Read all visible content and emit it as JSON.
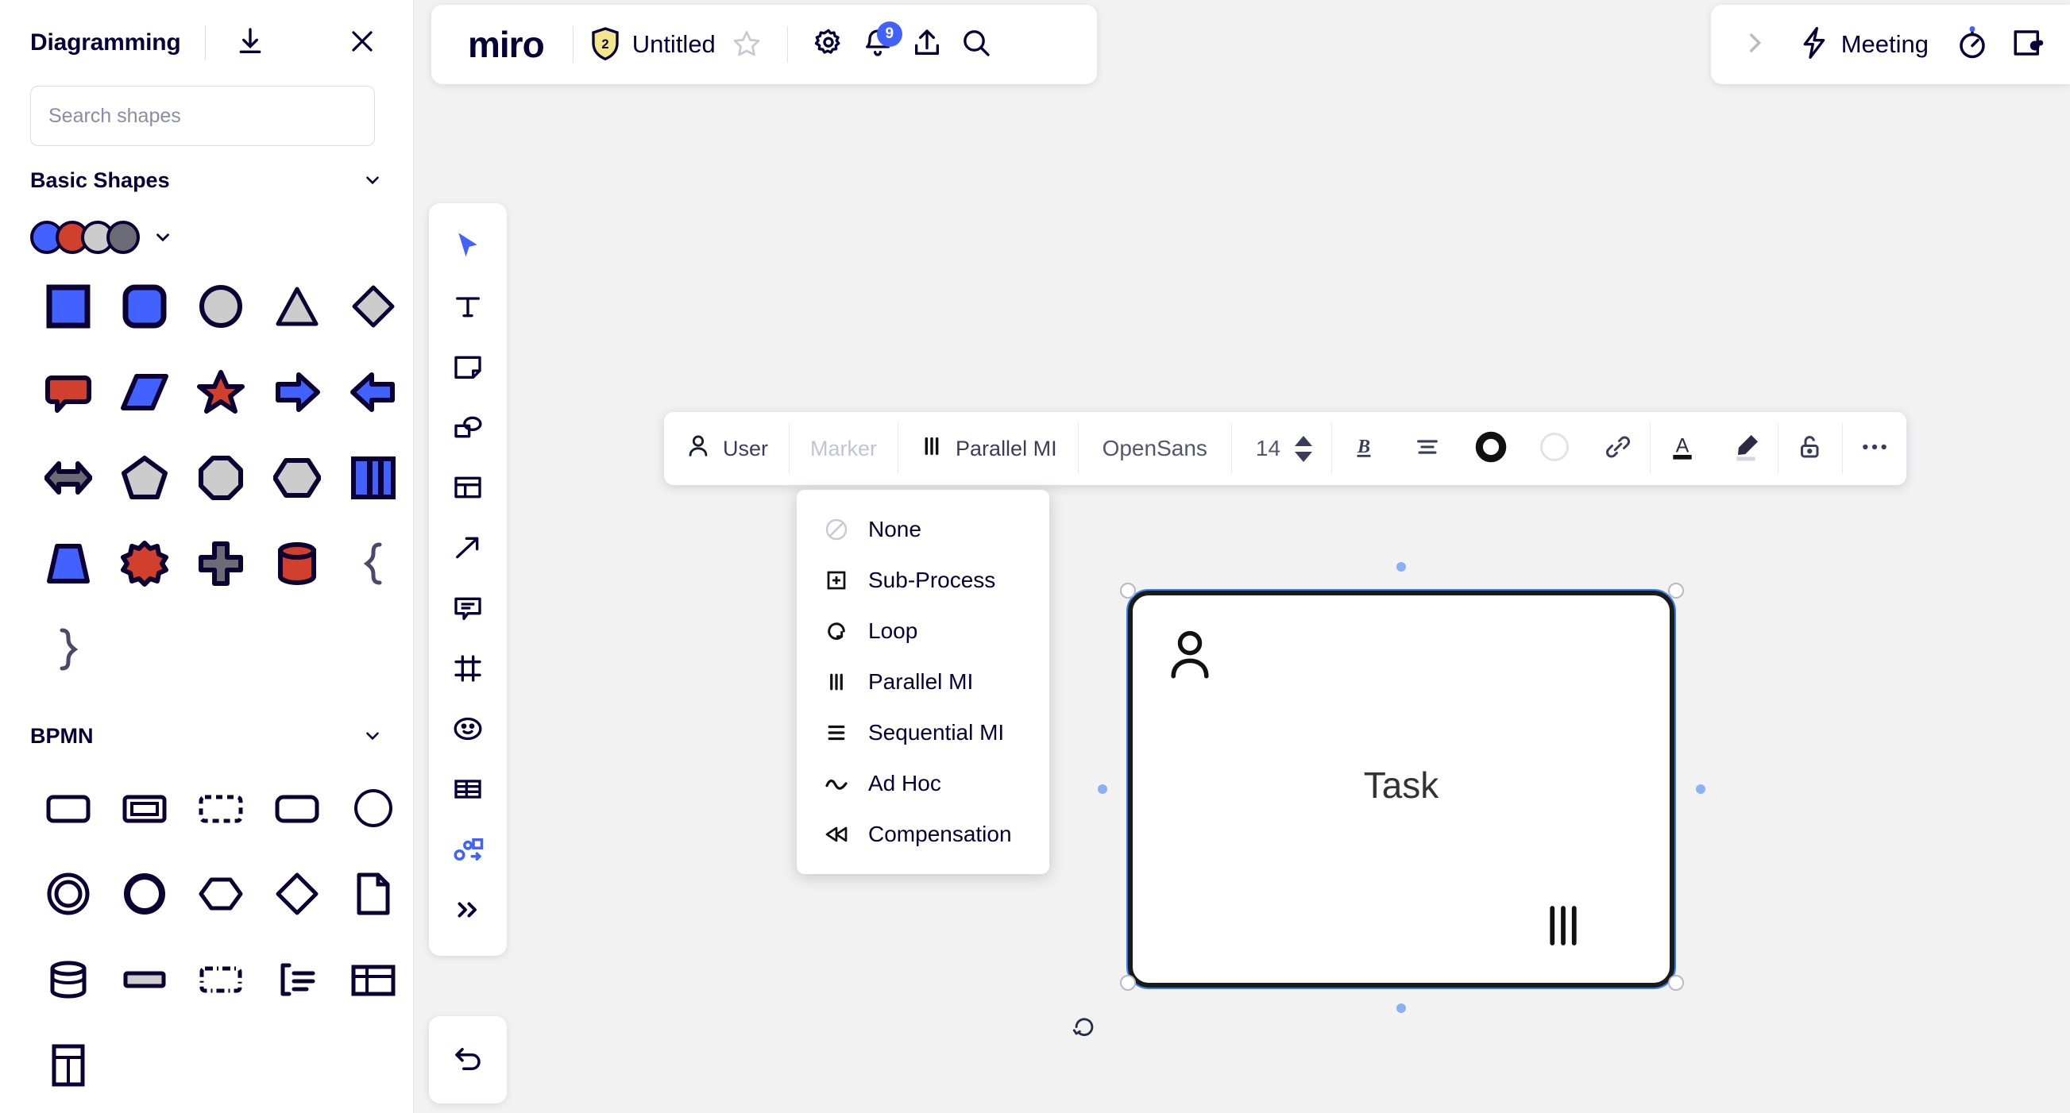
{
  "panel": {
    "title": "Diagramming",
    "download_icon": "download-icon",
    "close_icon": "close-icon",
    "search": {
      "placeholder": "Search shapes",
      "value": ""
    },
    "sections": [
      {
        "id": "basic-shapes",
        "title": "Basic Shapes",
        "expanded": true,
        "palette": [
          "#4262ff",
          "#d0402c",
          "#cccccc",
          "#6b6b76"
        ],
        "shapes": [
          "square",
          "rounded-square",
          "circle",
          "triangle",
          "diamond",
          "speech-bubble",
          "parallelogram",
          "star",
          "arrow-right",
          "arrow-left",
          "double-arrow",
          "pentagon",
          "octagon",
          "hexagon",
          "bars",
          "trapezoid",
          "burst",
          "cross",
          "cylinder",
          "brace-left",
          "brace-right"
        ]
      },
      {
        "id": "bpmn",
        "title": "BPMN",
        "expanded": true,
        "shapes": [
          "bpmn-task",
          "bpmn-subprocess",
          "bpmn-dashed-task",
          "bpmn-transaction",
          "bpmn-event",
          "bpmn-end-event",
          "bpmn-thick-circle",
          "bpmn-hexagon-gateway",
          "bpmn-diamond-gateway",
          "bpmn-data-object",
          "bpmn-data-store",
          "bpmn-group-bar",
          "bpmn-dashed-group",
          "bpmn-annotation",
          "bpmn-pool",
          "bpmn-lane"
        ]
      }
    ]
  },
  "topbar": {
    "logo": "miro",
    "plan_badge": "2",
    "board_title": "Untitled",
    "star_icon": "star-icon",
    "settings_icon": "gear-icon",
    "notifications_icon": "bell-icon",
    "notifications_count": "9",
    "share_icon": "upload-icon",
    "search_icon": "search-icon"
  },
  "topright": {
    "expand_icon": "chevron-right-icon",
    "meeting_icon": "bolt-icon",
    "meeting_label": "Meeting",
    "timer_icon": "timer-icon",
    "frames_icon": "screen-share-icon"
  },
  "tools": {
    "items": [
      {
        "name": "select-tool",
        "icon": "cursor-icon",
        "active": true
      },
      {
        "name": "text-tool",
        "icon": "text-icon",
        "active": false
      },
      {
        "name": "sticky-note-tool",
        "icon": "sticky-note-icon",
        "active": false
      },
      {
        "name": "shapes-tool",
        "icon": "shapes-icon",
        "active": false
      },
      {
        "name": "template-tool",
        "icon": "template-icon",
        "active": false
      },
      {
        "name": "connector-tool",
        "icon": "arrow-icon",
        "active": false
      },
      {
        "name": "comment-tool",
        "icon": "comment-icon",
        "active": false
      },
      {
        "name": "frame-tool",
        "icon": "frame-icon",
        "active": false
      },
      {
        "name": "emoji-tool",
        "icon": "smiley-icon",
        "active": false
      },
      {
        "name": "table-tool",
        "icon": "table-icon",
        "active": false
      },
      {
        "name": "diagramming-tool",
        "icon": "diagram-icon",
        "active": true
      },
      {
        "name": "more-tools",
        "icon": "chevrons-right-icon",
        "active": false
      }
    ],
    "undo": {
      "name": "undo-button",
      "icon": "undo-icon"
    }
  },
  "format_toolbar": {
    "shape_type": {
      "label": "User",
      "icon": "person-icon"
    },
    "marker_placeholder": {
      "label": "Marker"
    },
    "marker_selected": {
      "label": "Parallel MI",
      "icon": "parallel-mi-icon"
    },
    "font_family": "OpenSans",
    "font_size": "14",
    "bold_label": "B",
    "align_icon": "align-icon",
    "border_color_icon": "border-color-swatch",
    "fill_color_icon": "fill-color-swatch",
    "link_icon": "link-icon",
    "text_color_icon": "text-color-icon",
    "text_color_value": "#111111",
    "highlight_icon": "highlighter-icon",
    "lock_icon": "unlock-icon",
    "more_icon": "more-options-icon"
  },
  "marker_menu": {
    "items": [
      {
        "label": "None",
        "icon": "none-icon"
      },
      {
        "label": "Sub-Process",
        "icon": "sub-process-icon"
      },
      {
        "label": "Loop",
        "icon": "loop-icon"
      },
      {
        "label": "Parallel MI",
        "icon": "parallel-mi-icon"
      },
      {
        "label": "Sequential MI",
        "icon": "sequential-mi-icon"
      },
      {
        "label": "Ad Hoc",
        "icon": "ad-hoc-icon"
      },
      {
        "label": "Compensation",
        "icon": "compensation-icon"
      }
    ]
  },
  "canvas": {
    "selected_shape": {
      "label": "Task",
      "type": "bpmn-user-task",
      "user_icon": "person-icon",
      "marker_icon": "parallel-mi-icon",
      "selection_color": "#2d7ff9",
      "rotate_icon": "rotate-icon"
    }
  }
}
